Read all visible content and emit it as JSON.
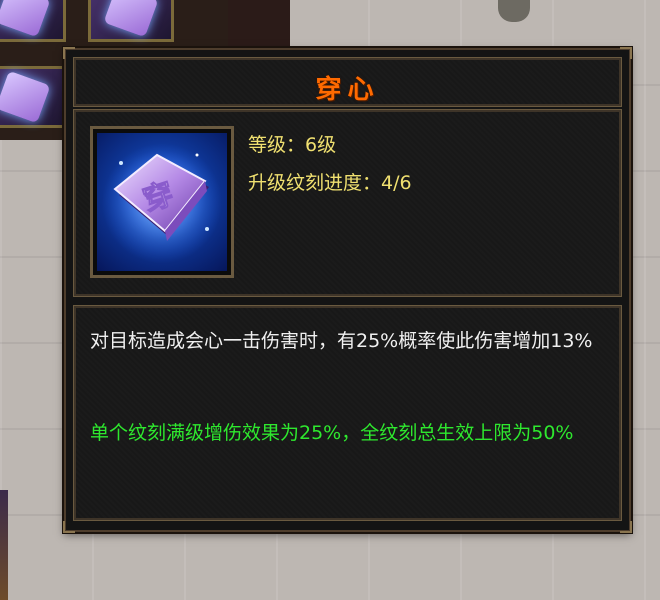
{
  "tooltip": {
    "title": "穿心",
    "level_line": "等级：6级",
    "progress_line": "升级纹刻进度：4/6",
    "description": "对目标造成会心一击伤害时，有25%概率使此伤害增加13%",
    "note": "单个纹刻满级增伤效果为25%，全纹刻总生效上限为50%",
    "icon": "purple-rune-book-icon",
    "icon_glyph": "穿"
  },
  "colors": {
    "title": "#ff6a00",
    "stats": "#f0e070",
    "description": "#f0f0f0",
    "note": "#2ee82e"
  }
}
